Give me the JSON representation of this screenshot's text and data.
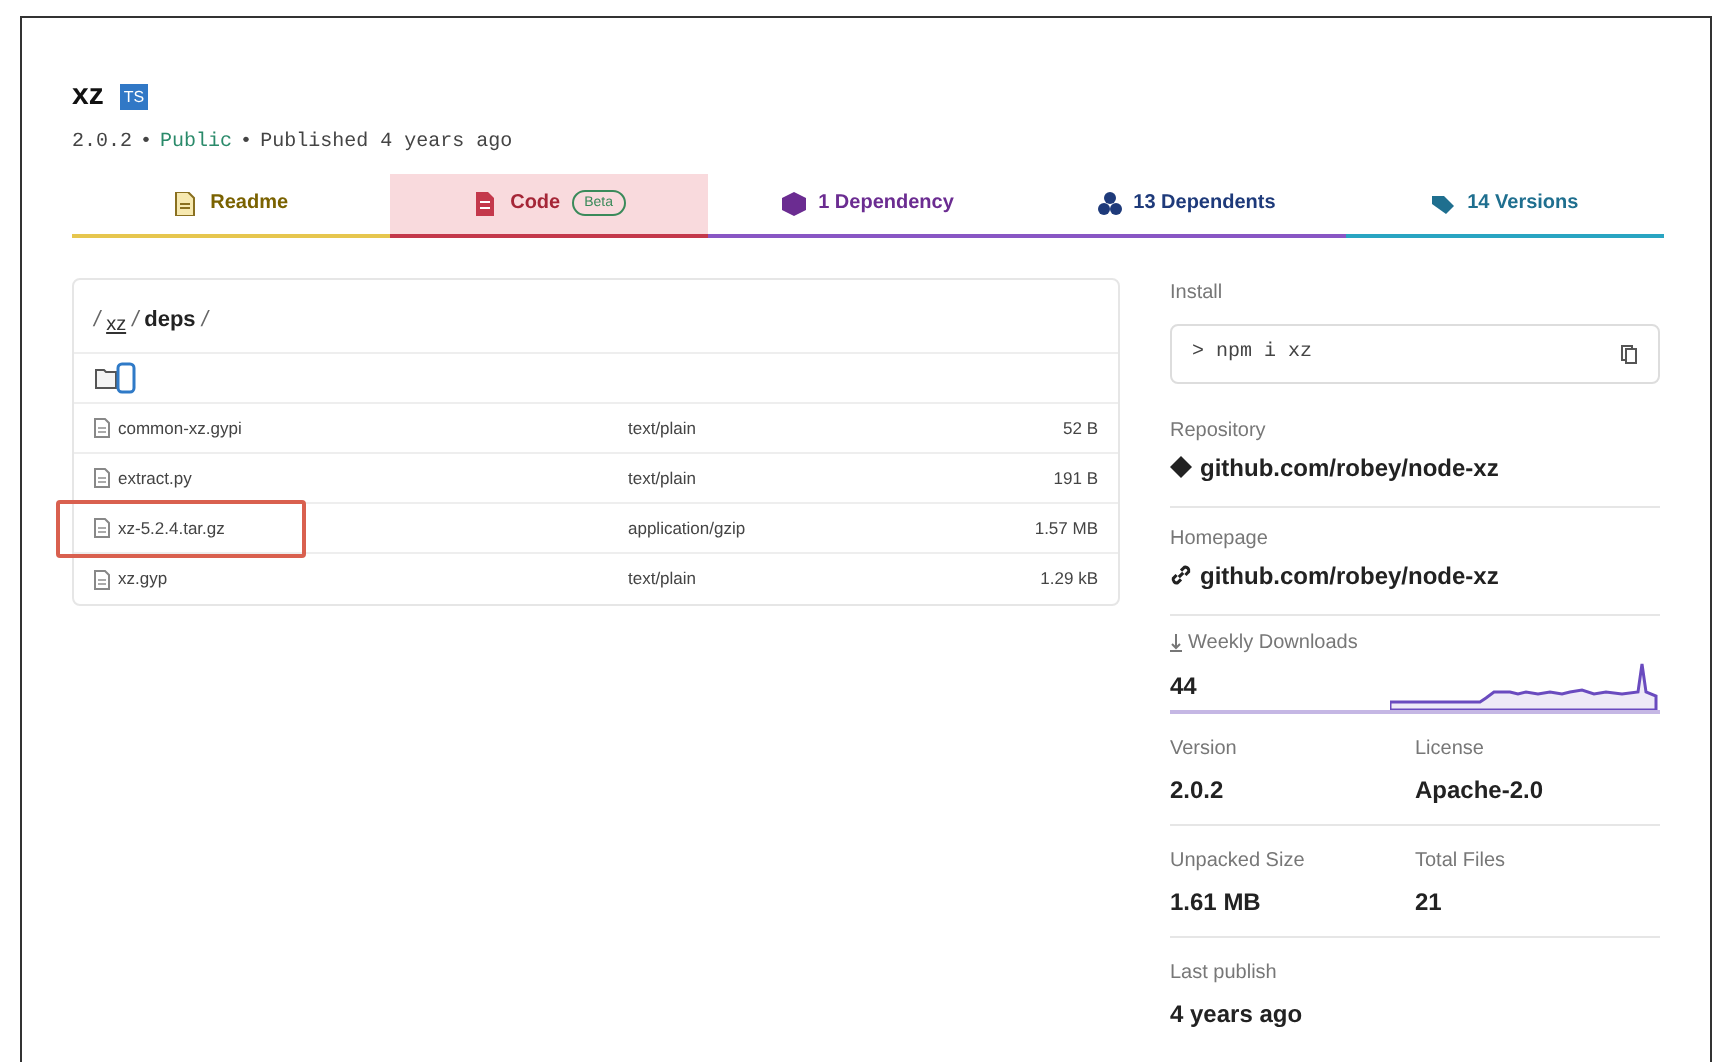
{
  "package": {
    "name": "xz",
    "types_badge": "TS",
    "meta": [
      {
        "kind": "version",
        "text": "2.0.2"
      },
      {
        "kind": "separator",
        "text": "•"
      },
      {
        "kind": "visibility",
        "text": "Public"
      },
      {
        "kind": "separator",
        "text": "•"
      },
      {
        "kind": "published",
        "text": "Published 4 years ago"
      }
    ]
  },
  "tabs": [
    {
      "kind": "readme",
      "label": "Readme",
      "selected": false,
      "color": "#e6c64e"
    },
    {
      "kind": "code",
      "label": "Code",
      "badge": "Beta",
      "selected": true,
      "color": "#c4384b"
    },
    {
      "kind": "dependency",
      "label": "1 Dependency",
      "selected": false,
      "color": "#8956c4"
    },
    {
      "kind": "dependents",
      "label": "13 Dependents",
      "selected": false,
      "color": "#8956c4"
    },
    {
      "kind": "versions",
      "label": "14 Versions",
      "selected": false,
      "color": "#29a5c2"
    }
  ],
  "file_browser": {
    "path": [
      {
        "kind": "separator",
        "label": "/"
      },
      {
        "kind": "link",
        "label": "xz"
      },
      {
        "kind": "separator",
        "label": "/"
      },
      {
        "kind": "folder",
        "label": "deps"
      },
      {
        "kind": "separator",
        "label": "/"
      }
    ],
    "files": [
      {
        "name": "common-xz.gypi",
        "type": "text/plain",
        "size": "52 B",
        "highlighted": false
      },
      {
        "name": "extract.py",
        "type": "text/plain",
        "size": "191 B",
        "highlighted": false
      },
      {
        "name": "xz-5.2.4.tar.gz",
        "type": "application/gzip",
        "size": "1.57 MB",
        "highlighted": true
      },
      {
        "name": "xz.gyp",
        "type": "text/plain",
        "size": "1.29 kB",
        "highlighted": false
      }
    ]
  },
  "sidebar": {
    "install_label": "Install",
    "install_command": "> npm i xz",
    "repository_label": "Repository",
    "repository": "github.com/robey/node-xz",
    "homepage_label": "Homepage",
    "homepage": "github.com/robey/node-xz",
    "downloads_label": "Weekly Downloads",
    "downloads": "44",
    "stats": [
      [
        {
          "label": "Version",
          "value": "2.0.2"
        },
        {
          "label": "License",
          "value": "Apache-2.0"
        }
      ],
      [
        {
          "label": "Unpacked Size",
          "value": "1.61 MB"
        },
        {
          "label": "Total Files",
          "value": "21"
        }
      ],
      [
        {
          "label": "Last publish",
          "value": "4 years ago"
        }
      ]
    ]
  }
}
